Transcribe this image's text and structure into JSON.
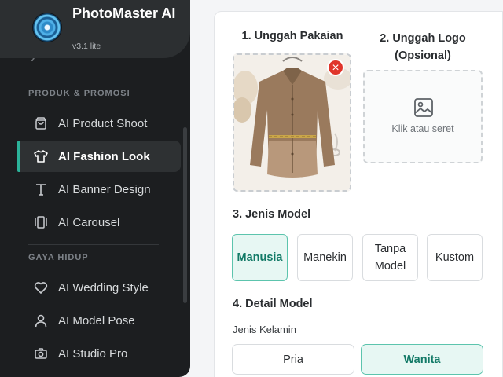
{
  "app": {
    "name": "PhotoMaster AI",
    "version": "v3.1 lite"
  },
  "sidebar": {
    "sections": [
      {
        "title": "PRODUK & PROMOSI",
        "items": [
          {
            "label": "AI Product Shoot",
            "icon": "shopping-bag-icon"
          },
          {
            "label": "AI Fashion Look",
            "icon": "tshirt-icon",
            "active": true
          },
          {
            "label": "AI Banner Design",
            "icon": "text-icon"
          },
          {
            "label": "AI Carousel",
            "icon": "carousel-icon"
          }
        ]
      },
      {
        "title": "GAYA HIDUP",
        "items": [
          {
            "label": "AI Wedding Style",
            "icon": "heart-icon"
          },
          {
            "label": "AI Model Pose",
            "icon": "user-icon"
          },
          {
            "label": "AI Studio Pro",
            "icon": "camera-icon"
          }
        ]
      }
    ]
  },
  "main": {
    "step1": {
      "title": "1. Unggah Pakaian"
    },
    "step2": {
      "title": "2. Unggah Logo (Opsional)",
      "hint": "Klik atau seret"
    },
    "step3": {
      "title": "3. Jenis Model",
      "options": [
        "Manusia",
        "Manekin",
        "Tanpa Model",
        "Kustom"
      ],
      "selected": "Manusia"
    },
    "step4": {
      "title": "4. Detail Model",
      "gender_label": "Jenis Kelamin",
      "gender_options": [
        "Pria",
        "Wanita"
      ],
      "gender_selected": "Wanita"
    }
  },
  "colors": {
    "accent": "#2bb39a",
    "sidebar_bg": "#1c1e20",
    "remove": "#e0352b"
  }
}
